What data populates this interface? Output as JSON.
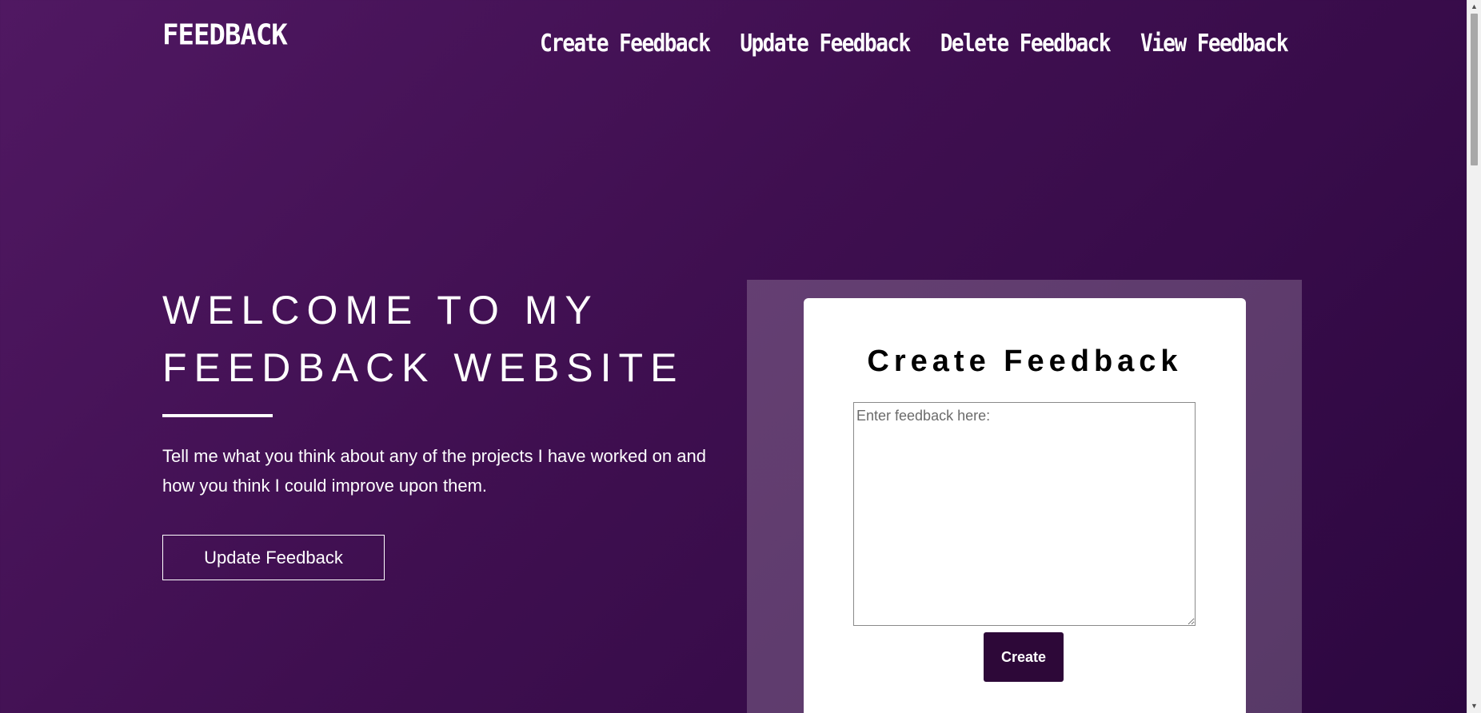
{
  "header": {
    "logo": "FEEDBACK",
    "nav": [
      {
        "label": "Create Feedback"
      },
      {
        "label": "Update Feedback"
      },
      {
        "label": "Delete Feedback"
      },
      {
        "label": "View Feedback"
      }
    ]
  },
  "hero": {
    "title_line1": "WELCOME TO MY",
    "title_line2": "FEEDBACK WEBSITE",
    "description": "Tell me what you think about any of the projects I have worked on and how you think I could improve upon them.",
    "button_label": "Update Feedback"
  },
  "form": {
    "title": "Create Feedback",
    "textarea_value": "",
    "textarea_placeholder": "Enter feedback here:",
    "submit_label": "Create"
  },
  "scrollbar": {
    "up_icon": "scroll-up-arrow-icon",
    "down_icon": "scroll-down-arrow-icon"
  },
  "colors": {
    "background_start": "#501862",
    "background_end": "#2c0740",
    "button_dark": "#2d0838"
  }
}
